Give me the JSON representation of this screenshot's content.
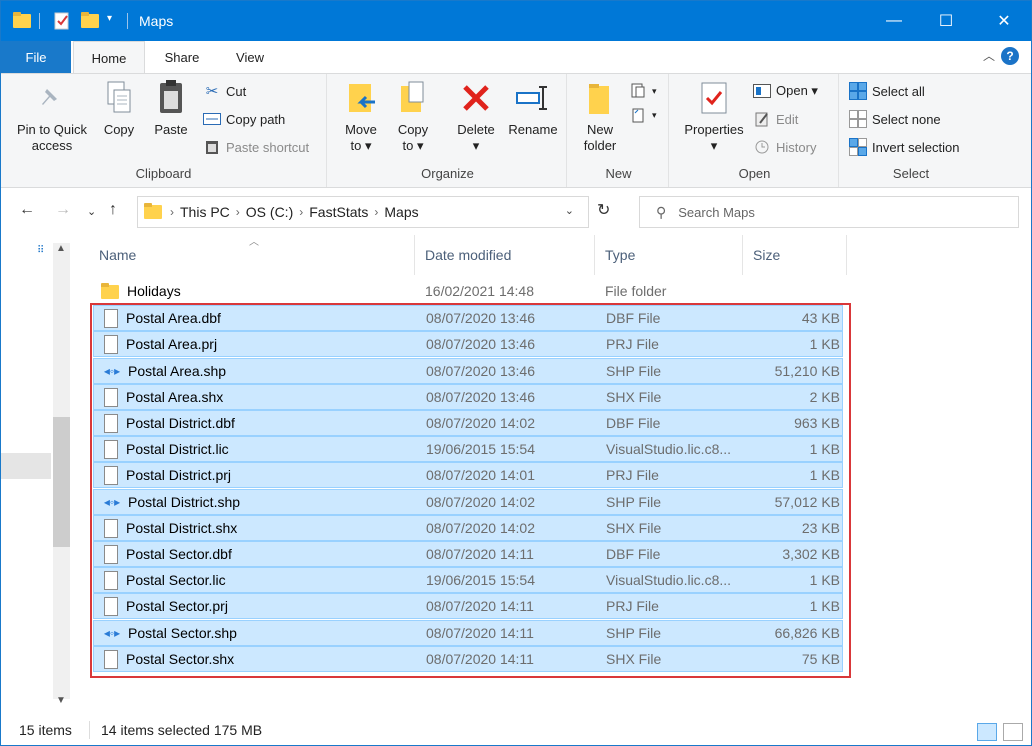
{
  "window": {
    "title": "Maps",
    "controls": {
      "minimize": "—",
      "maximize": "☐",
      "close": "✕"
    }
  },
  "ribbon_tabs": {
    "file": "File",
    "home": "Home",
    "share": "Share",
    "view": "View"
  },
  "ribbon": {
    "clipboard": {
      "label": "Clipboard",
      "pin": "Pin to Quick",
      "pin2": "access",
      "copy": "Copy",
      "paste": "Paste",
      "cut": "Cut",
      "copy_path": "Copy path",
      "paste_shortcut": "Paste shortcut"
    },
    "organize": {
      "label": "Organize",
      "move_to": "Move",
      "move_to2": "to ▾",
      "copy_to": "Copy",
      "copy_to2": "to ▾",
      "delete": "Delete",
      "delete2": "▾",
      "rename": "Rename"
    },
    "new": {
      "label": "New",
      "new_folder": "New",
      "new_folder2": "folder"
    },
    "open": {
      "label": "Open",
      "properties": "Properties",
      "properties2": "▾",
      "open": "Open ▾",
      "edit": "Edit",
      "history": "History"
    },
    "select": {
      "label": "Select",
      "select_all": "Select all",
      "select_none": "Select none",
      "invert": "Invert selection"
    }
  },
  "address": {
    "crumbs": [
      "This PC",
      "OS (C:)",
      "FastStats",
      "Maps"
    ],
    "search_placeholder": "Search Maps"
  },
  "columns": {
    "name": "Name",
    "date": "Date modified",
    "type": "Type",
    "size": "Size"
  },
  "files": [
    {
      "name": "Holidays",
      "date": "16/02/2021 14:48",
      "type": "File folder",
      "size": "",
      "icon": "folder-icon",
      "selected": false
    },
    {
      "name": "Postal Area.dbf",
      "date": "08/07/2020 13:46",
      "type": "DBF File",
      "size": "43 KB",
      "icon": "document-icon",
      "selected": true
    },
    {
      "name": "Postal Area.prj",
      "date": "08/07/2020 13:46",
      "type": "PRJ File",
      "size": "1 KB",
      "icon": "document-icon",
      "selected": true
    },
    {
      "name": "Postal Area.shp",
      "date": "08/07/2020 13:46",
      "type": "SHP File",
      "size": "51,210 KB",
      "icon": "shape-file-icon",
      "selected": true
    },
    {
      "name": "Postal Area.shx",
      "date": "08/07/2020 13:46",
      "type": "SHX File",
      "size": "2 KB",
      "icon": "document-icon",
      "selected": true
    },
    {
      "name": "Postal District.dbf",
      "date": "08/07/2020 14:02",
      "type": "DBF File",
      "size": "963 KB",
      "icon": "document-icon",
      "selected": true
    },
    {
      "name": "Postal District.lic",
      "date": "19/06/2015 15:54",
      "type": "VisualStudio.lic.c8...",
      "size": "1 KB",
      "icon": "document-icon",
      "selected": true
    },
    {
      "name": "Postal District.prj",
      "date": "08/07/2020 14:01",
      "type": "PRJ File",
      "size": "1 KB",
      "icon": "document-icon",
      "selected": true
    },
    {
      "name": "Postal District.shp",
      "date": "08/07/2020 14:02",
      "type": "SHP File",
      "size": "57,012 KB",
      "icon": "shape-file-icon",
      "selected": true
    },
    {
      "name": "Postal District.shx",
      "date": "08/07/2020 14:02",
      "type": "SHX File",
      "size": "23 KB",
      "icon": "document-icon",
      "selected": true
    },
    {
      "name": "Postal Sector.dbf",
      "date": "08/07/2020 14:11",
      "type": "DBF File",
      "size": "3,302 KB",
      "icon": "document-icon",
      "selected": true
    },
    {
      "name": "Postal Sector.lic",
      "date": "19/06/2015 15:54",
      "type": "VisualStudio.lic.c8...",
      "size": "1 KB",
      "icon": "document-icon",
      "selected": true
    },
    {
      "name": "Postal Sector.prj",
      "date": "08/07/2020 14:11",
      "type": "PRJ File",
      "size": "1 KB",
      "icon": "document-icon",
      "selected": true
    },
    {
      "name": "Postal Sector.shp",
      "date": "08/07/2020 14:11",
      "type": "SHP File",
      "size": "66,826 KB",
      "icon": "shape-file-icon",
      "selected": true
    },
    {
      "name": "Postal Sector.shx",
      "date": "08/07/2020 14:11",
      "type": "SHX File",
      "size": "75 KB",
      "icon": "document-icon",
      "selected": true
    }
  ],
  "status": {
    "count": "15 items",
    "selected": "14 items selected 175 MB"
  },
  "colors": {
    "titlebar": "#0078d7",
    "selection": "#cce8ff",
    "highlight_box": "#d9383a"
  }
}
